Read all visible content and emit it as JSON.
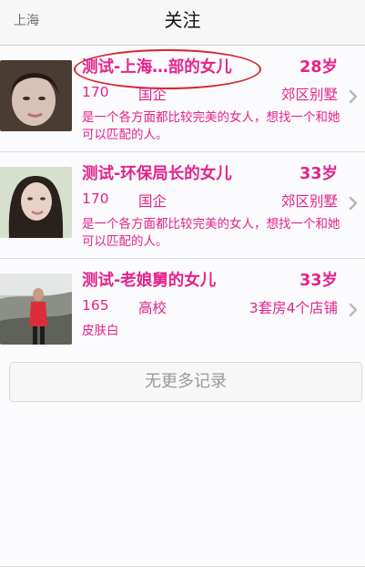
{
  "header": {
    "location": "上海",
    "title": "关注"
  },
  "items": [
    {
      "name": "测试-上海…部的女儿",
      "age": "28岁",
      "height": "170",
      "job": "国企",
      "house": "郊区别墅",
      "desc": "是一个各方面都比较完美的女人，想找一个和她可以匹配的人。"
    },
    {
      "name": "测试-环保局长的女儿",
      "age": "33岁",
      "height": "170",
      "job": "国企",
      "house": "郊区别墅",
      "desc": "是一个各方面都比较完美的女人，想找一个和她可以匹配的人。"
    },
    {
      "name": "测试-老娘舅的女儿",
      "age": "33岁",
      "height": "165",
      "job": "高校",
      "house": "3套房4个店铺",
      "desc": "皮肤白"
    }
  ],
  "footer": {
    "label": "无更多记录"
  },
  "colors": {
    "accent": "#e4228a",
    "highlight": "#d8262d"
  }
}
